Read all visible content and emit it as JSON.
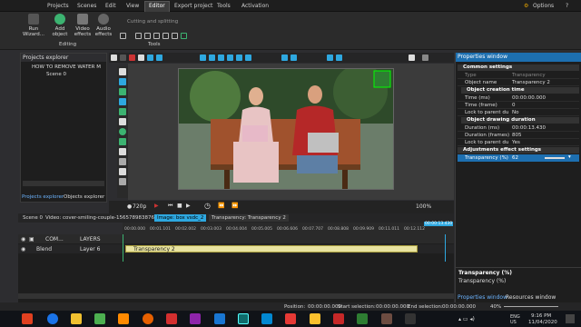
{
  "menubar": {
    "items": [
      "Projects",
      "Scenes",
      "Edit",
      "View",
      "Editor",
      "Export project",
      "Tools",
      "Activation"
    ],
    "active": "Editor",
    "options": "Options"
  },
  "ribbon": {
    "run_wizard": "Run Wizard...",
    "add_object": "Add object",
    "video_effects": "Video effects",
    "audio_effects": "Audio effects",
    "editing_group": "Editing",
    "tools_group": "Tools",
    "cutting_label": "Cutting and splitting"
  },
  "projects_explorer": {
    "title": "Projects explorer",
    "project_name": "HOW TO REMOVE WATER M",
    "scene": "Scene 0",
    "tab_projects": "Projects explorer",
    "tab_objects": "Objects explorer"
  },
  "playback": {
    "quality": "720p",
    "zoom": "100%"
  },
  "properties": {
    "title": "Properties window",
    "common_settings": "Common settings",
    "type_key": "Type",
    "type_val": "Transparency",
    "name_key": "Object name",
    "name_val": "Transparency 2",
    "creation_time": "Object creation time",
    "time_ms_key": "Time (ms)",
    "time_ms_val": "00:00:00.000",
    "time_frame_key": "Time (frame)",
    "time_frame_val": "0",
    "lock_key": "Lock to parent du",
    "lock_val": "No",
    "drawing_duration": "Object drawing duration",
    "dur_ms_key": "Duration (ms)",
    "dur_ms_val": "00:00:13.430",
    "dur_frames_key": "Duration (frames)",
    "dur_frames_val": "805",
    "lock2_key": "Lock to parent du",
    "lock2_val": "Yes",
    "adjust_settings": "Adjustments effect settings",
    "transp_key": "Transparency (%)",
    "transp_val": "62",
    "desc_title": "Transparency (%)",
    "desc_text": "Transparency (%)",
    "tab_props": "Properties window",
    "tab_resources": "Resources window"
  },
  "timeline": {
    "tabs": [
      "Scene 0",
      "Video: cover-smiling-couple-1565789838761_1",
      "Image: box vsdc_2",
      "Transparency: Transparency 2"
    ],
    "com_label": "COM...",
    "layers_label": "LAYERS",
    "blend_label": "Blend",
    "layer6": "Layer 6",
    "clip_label": "Transparency 2",
    "ruler": [
      "00:00.000",
      "00:01.101",
      "00:02.002",
      "00:03.003",
      "00:04.004",
      "00:05.005",
      "00:06.606",
      "00:07.707",
      "00:08.808",
      "00:09.909",
      "00:11.011",
      "00:12.112",
      "00:13.213",
      "00:14.314"
    ],
    "playhead": "00:00:13.430"
  },
  "status": {
    "position_label": "Position:",
    "position_val": "00:00:00.000",
    "start_label": "Start selection:",
    "start_val": "00:00:00.000",
    "end_label": "End selection:",
    "end_val": "00:00:00.000",
    "zoom": "40%"
  },
  "taskbar": {
    "lang": "ENG US",
    "time": "9:16 PM",
    "date": "11/04/2020"
  }
}
